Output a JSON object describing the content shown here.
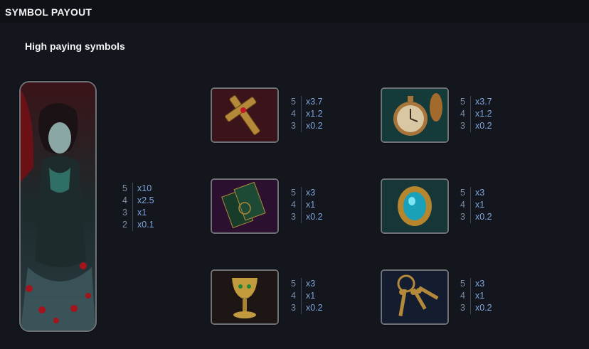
{
  "header": {
    "title": "SYMBOL PAYOUT"
  },
  "section": {
    "title": "High paying symbols"
  },
  "symbols": [
    {
      "icon": "vampire-lady-icon",
      "payouts": [
        {
          "count": "5",
          "mult": "x10"
        },
        {
          "count": "4",
          "mult": "x2.5"
        },
        {
          "count": "3",
          "mult": "x1"
        },
        {
          "count": "2",
          "mult": "x0.1"
        }
      ]
    },
    {
      "icon": "cross-icon",
      "payouts": [
        {
          "count": "5",
          "mult": "x3.7"
        },
        {
          "count": "4",
          "mult": "x1.2"
        },
        {
          "count": "3",
          "mult": "x0.2"
        }
      ]
    },
    {
      "icon": "pocket-watch-icon",
      "payouts": [
        {
          "count": "5",
          "mult": "x3.7"
        },
        {
          "count": "4",
          "mult": "x1.2"
        },
        {
          "count": "3",
          "mult": "x0.2"
        }
      ]
    },
    {
      "icon": "tarot-cards-icon",
      "payouts": [
        {
          "count": "5",
          "mult": "x3"
        },
        {
          "count": "4",
          "mult": "x1"
        },
        {
          "count": "3",
          "mult": "x0.2"
        }
      ]
    },
    {
      "icon": "gem-brooch-icon",
      "payouts": [
        {
          "count": "5",
          "mult": "x3"
        },
        {
          "count": "4",
          "mult": "x1"
        },
        {
          "count": "3",
          "mult": "x0.2"
        }
      ]
    },
    {
      "icon": "goblet-icon",
      "payouts": [
        {
          "count": "5",
          "mult": "x3"
        },
        {
          "count": "4",
          "mult": "x1"
        },
        {
          "count": "3",
          "mult": "x0.2"
        }
      ]
    },
    {
      "icon": "keys-icon",
      "payouts": [
        {
          "count": "5",
          "mult": "x3"
        },
        {
          "count": "4",
          "mult": "x1"
        },
        {
          "count": "3",
          "mult": "x0.2"
        }
      ]
    }
  ],
  "colors": {
    "background": "#13161d",
    "header": "#0f1116",
    "multiplier": "#7ea6dc",
    "count": "#7d8fa8"
  }
}
